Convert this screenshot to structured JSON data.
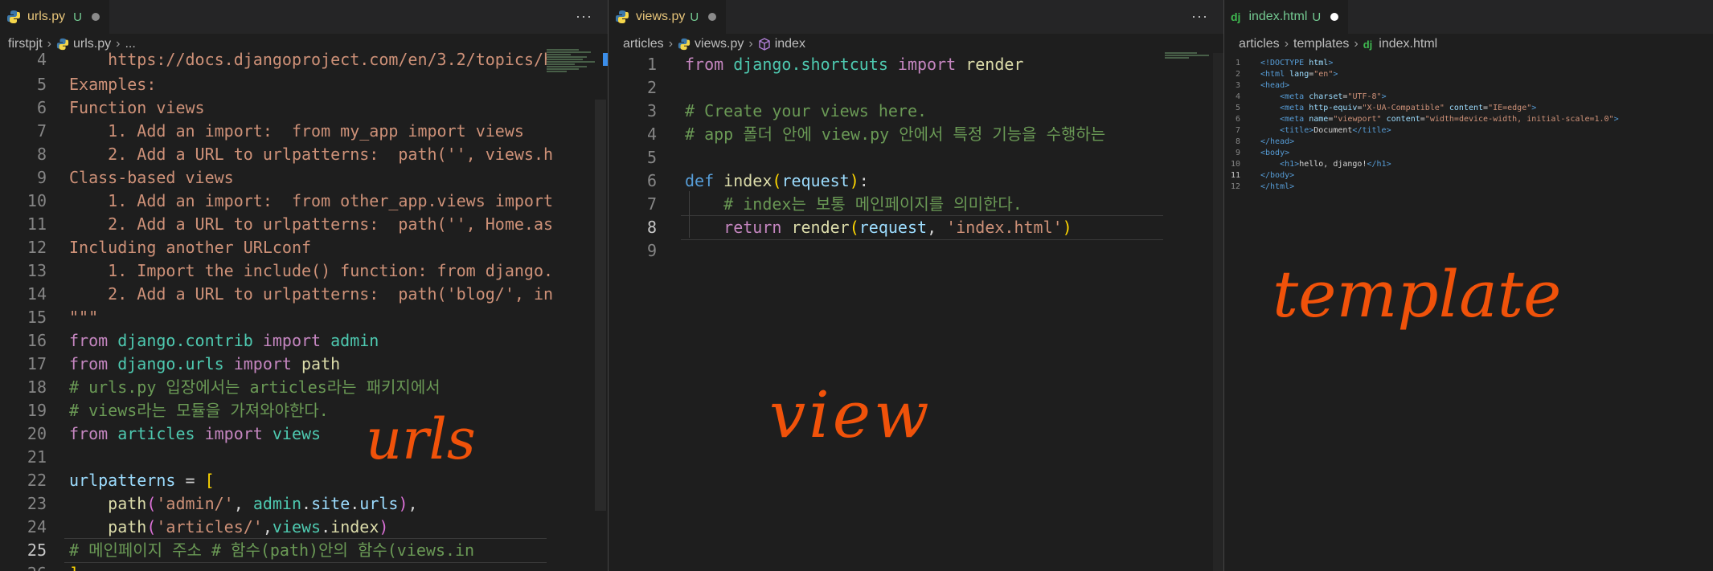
{
  "pane1": {
    "tab": {
      "name": "urls.py",
      "modified": "U"
    },
    "more": "···",
    "breadcrumb": [
      "firstpjt",
      "urls.py",
      "..."
    ],
    "lines": [
      {
        "n": "4",
        "text": "    https://docs.djangoproject.com/en/3.2/topics/h"
      },
      {
        "n": "5",
        "text": "Examples:"
      },
      {
        "n": "6",
        "text": "Function views"
      },
      {
        "n": "7",
        "text": "    1. Add an import:  from my_app import views"
      },
      {
        "n": "8",
        "text": "    2. Add a URL to urlpatterns:  path('', views.h"
      },
      {
        "n": "9",
        "text": "Class-based views"
      },
      {
        "n": "10",
        "text": "    1. Add an import:  from other_app.views import"
      },
      {
        "n": "11",
        "text": "    2. Add a URL to urlpatterns:  path('', Home.as"
      },
      {
        "n": "12",
        "text": "Including another URLconf"
      },
      {
        "n": "13",
        "text": "    1. Import the include() function: from django."
      },
      {
        "n": "14",
        "text": "    2. Add a URL to urlpatterns:  path('blog/', in"
      },
      {
        "n": "15",
        "text": "\"\"\""
      }
    ],
    "code": {
      "l16": [
        "from",
        "django.contrib",
        "import",
        "admin"
      ],
      "l17": [
        "from",
        "django.urls",
        "import",
        "path"
      ],
      "l18": "# urls.py 입장에서는 articles라는 패키지에서",
      "l19": "# views라는 모듈을 가져와야한다.",
      "l20": [
        "from",
        "articles",
        "import",
        "views"
      ],
      "l22": [
        "urlpatterns",
        " = ",
        "["
      ],
      "l23": [
        "path",
        "'admin/'",
        "admin",
        "site",
        "urls"
      ],
      "l24": [
        "path",
        "'articles/'",
        "views",
        "index"
      ],
      "l25": "# 메인페이지 주소 # 함수(path)안의 함수(views.in",
      "l26": "]"
    },
    "annotation": "urls"
  },
  "pane2": {
    "tab": {
      "name": "views.py",
      "modified": "U"
    },
    "more": "···",
    "breadcrumb": [
      "articles",
      "views.py",
      "index"
    ],
    "code": {
      "l1": [
        "from",
        "django.shortcuts",
        "import",
        "render"
      ],
      "l3": "# Create your views here.",
      "l4": "# app 폴더 안에 view.py 안에서 특정 기능을 수행하는",
      "l6": [
        "def",
        "index",
        "request"
      ],
      "l7": "# index는 보통 메인페이지를 의미한다.",
      "l8": [
        "return",
        "render",
        "request",
        "'index.html'"
      ]
    },
    "annotation": "view"
  },
  "pane3": {
    "tab": {
      "name": "index.html",
      "modified": "U"
    },
    "breadcrumb": [
      "articles",
      "templates",
      "index.html"
    ],
    "html": {
      "l1": [
        "<!DOCTYPE",
        "html",
        ">"
      ],
      "l5": [
        "\"UTF-8\""
      ],
      "l6": [
        "\"X-UA-Compatible\"",
        "\"IE=edge\""
      ],
      "l7": [
        "\"viewport\"",
        "\"width=device-width, initial-scale=1.0\""
      ],
      "l8": "Document",
      "l11": "hello, django!"
    },
    "annotation": "template"
  }
}
